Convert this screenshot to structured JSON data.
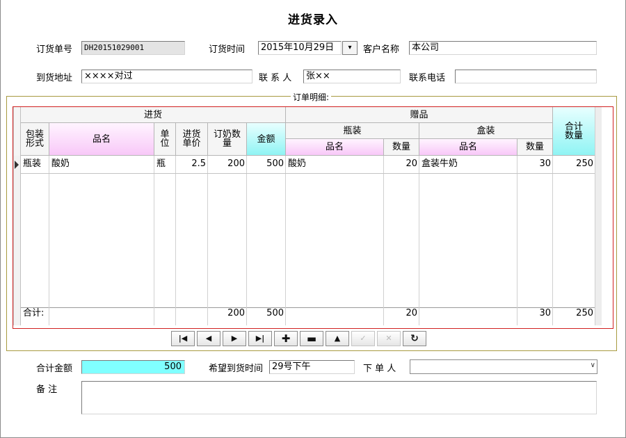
{
  "window": {
    "title": "进货录入"
  },
  "form": {
    "order_no_label": "订货单号",
    "order_no": "DH20151029001",
    "order_time_label": "订货时间",
    "order_time": "2015年10月29日",
    "customer_label": "客户名称",
    "customer": "本公司",
    "address_label": "到货地址",
    "address": "××××对过",
    "contact_label": "联 系 人",
    "contact": "张××",
    "phone_label": "联系电话",
    "phone": ""
  },
  "detail": {
    "caption": "订单明细:",
    "group_headers": {
      "purchase": "进货",
      "gift": "赠品",
      "bottle": "瓶装",
      "box": "盒装",
      "total_qty": "合计数量"
    },
    "columns": {
      "pack": "包装形式",
      "name": "品名",
      "unit": "单位",
      "unit_price": "进货单价",
      "order_qty": "订奶数量",
      "amount": "金额",
      "bottle_name": "品名",
      "bottle_qty": "数量",
      "box_name": "品名",
      "box_qty": "数量"
    },
    "rows": [
      {
        "pack": "瓶装",
        "name": "酸奶",
        "unit": "瓶",
        "unit_price": "2.5",
        "order_qty": "200",
        "amount": "500",
        "bottle_name": "酸奶",
        "bottle_qty": "20",
        "box_name": "盒装牛奶",
        "box_qty": "30",
        "total_qty": "250"
      }
    ],
    "totals": {
      "label": "合计:",
      "order_qty": "200",
      "amount": "500",
      "bottle_qty": "20",
      "box_qty": "30",
      "total_qty": "250"
    }
  },
  "navigator": {
    "first": "first-icon",
    "prev": "prev-icon",
    "next": "next-icon",
    "last": "last-icon",
    "insert": "plus-icon",
    "delete": "minus-icon",
    "edit": "up-icon",
    "post": "check-icon",
    "cancel": "cancel-icon",
    "refresh": "refresh-icon"
  },
  "footer": {
    "total_amount_label": "合计金额",
    "total_amount": "500",
    "expected_time_label": "希望到货时间",
    "expected_time": "29号下午",
    "orderer_label": "下 单 人",
    "orderer": "",
    "remark_label": "备   注",
    "remark": ""
  },
  "colors": {
    "group_border": "#a89a40",
    "grid_frame": "#d02020",
    "highlight_cyan": "#80ffff",
    "header_pink": "#f8c8f8"
  }
}
